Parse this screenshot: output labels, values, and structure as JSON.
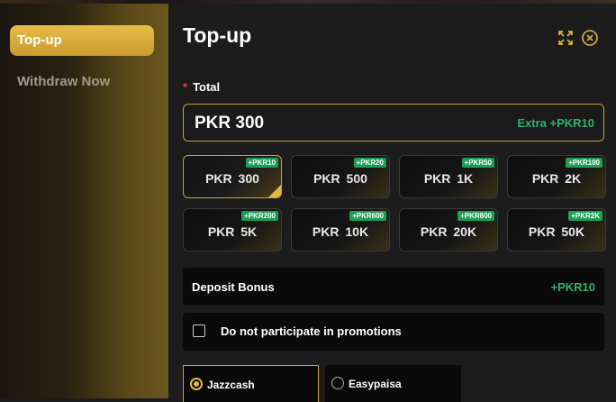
{
  "sidebar": {
    "items": [
      {
        "label": "Top-up",
        "active": true
      },
      {
        "label": "Withdraw Now",
        "active": false
      }
    ]
  },
  "header": {
    "title": "Top-up",
    "icons": [
      "expand-icon",
      "close-icon"
    ]
  },
  "total": {
    "label": "Total",
    "required_marker": "*",
    "value": "PKR 300",
    "extra": "Extra +PKR10"
  },
  "amounts": [
    {
      "label": "PKR 300",
      "badge": "+PKR10",
      "selected": true
    },
    {
      "label": "PKR 500",
      "badge": "+PKR20",
      "selected": false
    },
    {
      "label": "PKR 1K",
      "badge": "+PKR50",
      "selected": false
    },
    {
      "label": "PKR 2K",
      "badge": "+PKR100",
      "selected": false
    },
    {
      "label": "PKR 5K",
      "badge": "+PKR200",
      "selected": false
    },
    {
      "label": "PKR 10K",
      "badge": "+PKR600",
      "selected": false
    },
    {
      "label": "PKR 20K",
      "badge": "+PKR800",
      "selected": false
    },
    {
      "label": "PKR 50K",
      "badge": "+PKR2K",
      "selected": false
    }
  ],
  "bonus": {
    "label": "Deposit Bonus",
    "value": "+PKR10"
  },
  "promotion": {
    "label": "Do not participate in promotions",
    "checked": false
  },
  "payment_methods": [
    {
      "label": "Jazzcash",
      "selected": true
    },
    {
      "label": "Easypaisa",
      "selected": false
    }
  ],
  "colors": {
    "accent": "#e2b844",
    "bonus_green": "#2fb36a",
    "badge_green": "#1e9e55",
    "required_red": "#e04040"
  }
}
